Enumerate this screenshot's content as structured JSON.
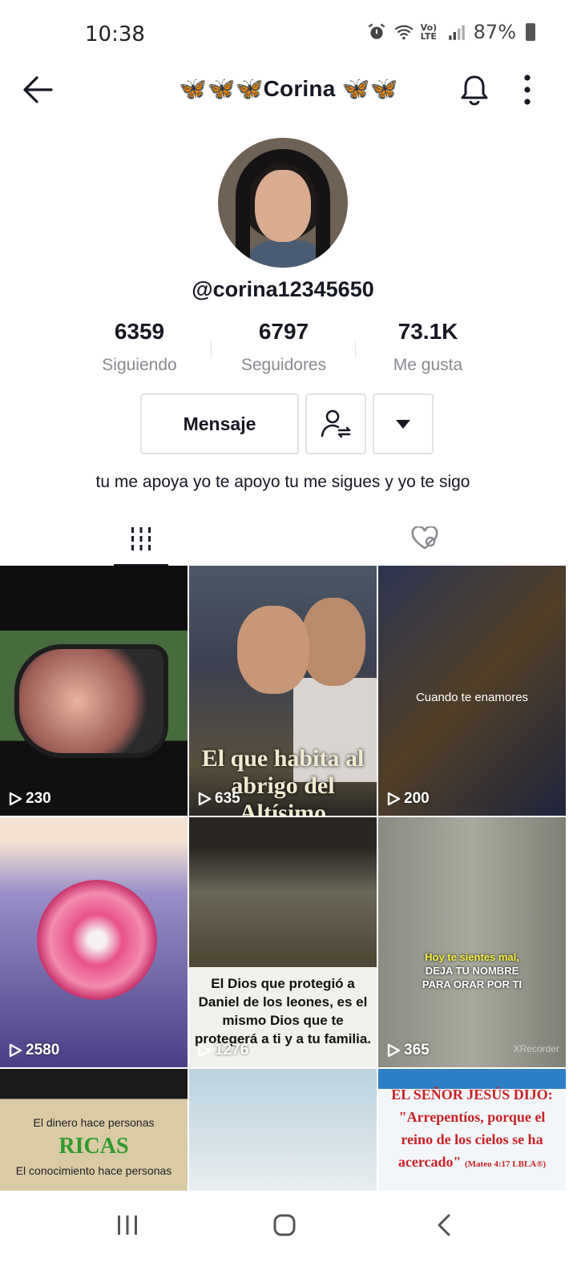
{
  "status_bar": {
    "time": "10:38",
    "battery": "87%",
    "network": "Vo) LTE"
  },
  "header": {
    "title": "🦋🦋🦋Corina 🦋🦋"
  },
  "profile": {
    "username": "@corina12345650",
    "stats": [
      {
        "value": "6359",
        "label": "Siguiendo"
      },
      {
        "value": "6797",
        "label": "Seguidores"
      },
      {
        "value": "73.1K",
        "label": "Me gusta"
      }
    ],
    "message_button": "Mensaje",
    "bio": "tu me apoya  yo te apoyo tu me sigues y yo te sigo"
  },
  "tabs": [
    {
      "icon": "grid-icon",
      "selected": true
    },
    {
      "icon": "liked-heart-icon",
      "selected": false
    }
  ],
  "videos": [
    {
      "views": "230",
      "text": ""
    },
    {
      "views": "635",
      "text": "El que habita al abrigo del Altísimo"
    },
    {
      "views": "200",
      "text": "Cuando te enamores"
    },
    {
      "views": "2580",
      "text": ""
    },
    {
      "views": "1276",
      "text": "El Dios que protegió a Daniel de los leones, es el mismo Dios que te protegerá a ti y a tu familia."
    },
    {
      "views": "365",
      "text_line1": "Hoy te sientes mal,",
      "text_line2": "DEJA TU NOMBRE",
      "text_line3": "PARA ORAR POR TI",
      "watermark": "XRecorder"
    },
    {
      "text_line1": "El dinero  hace personas",
      "text_big": "RICAS",
      "text_line2": "El conocimiento hace personas"
    },
    {
      "text": ""
    },
    {
      "text_line1": "EL SEÑOR JESÚS DIJO:",
      "text_line2": "\"Arrepentíos, porque el",
      "text_line3": "reino de los cielos se ha",
      "text_line4": "acercado\"",
      "ref": "(Mateo 4:17 LBLA®)"
    }
  ]
}
